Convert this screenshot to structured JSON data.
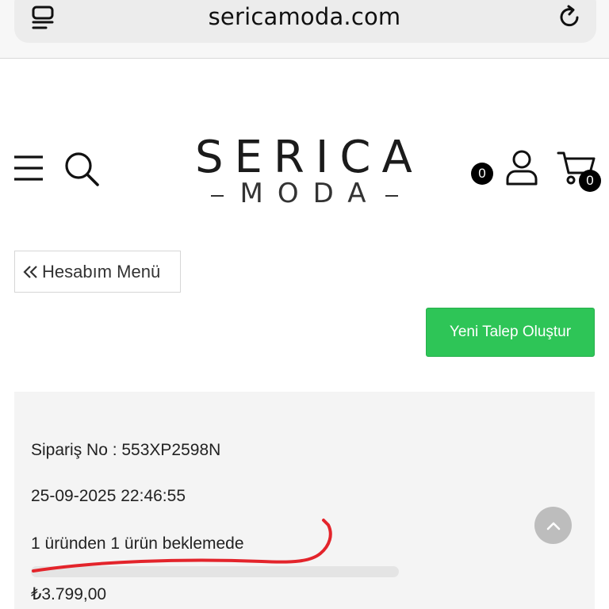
{
  "browser": {
    "url": "sericamoda.com",
    "tabs_icon": "tabs-icon",
    "reload_icon": "reload-icon"
  },
  "header": {
    "logo_top": "SERICA",
    "logo_bottom": "MODA",
    "menu_icon": "hamburger-menu-icon",
    "search_icon": "search-icon",
    "wishlist_count": "0",
    "user_icon": "user-icon",
    "cart_icon": "cart-icon",
    "cart_count": "0"
  },
  "actions": {
    "account_menu_label": "Hesabım Menü",
    "new_request_label": "Yeni Talep Oluştur"
  },
  "order": {
    "order_no": "Sipariş No : 553XP2598N",
    "date": "25-09-2025 22:46:55",
    "status": "1 üründen 1 ürün beklemede",
    "progress": 0,
    "price": "₺3.799,00"
  },
  "colors": {
    "accent_green": "#2ec557",
    "card_bg": "#f4f4f4",
    "annotation_red": "#e3242b"
  }
}
